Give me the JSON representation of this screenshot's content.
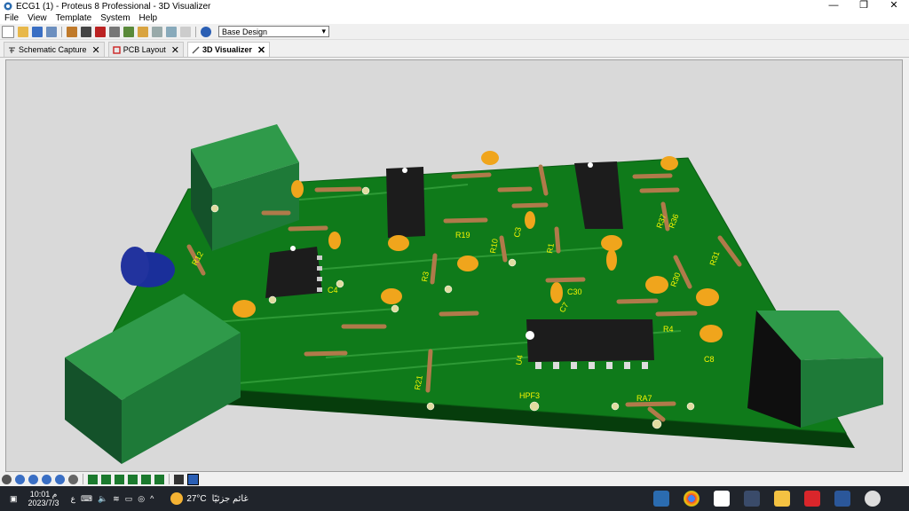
{
  "window": {
    "title": "ECG1 (1) - Proteus 8 Professional - 3D Visualizer",
    "minimize": "—",
    "maximize": "❐",
    "close": "✕"
  },
  "menu": [
    "File",
    "View",
    "Template",
    "System",
    "Help"
  ],
  "toolbar": {
    "variant_select": "Base Design"
  },
  "tabs": [
    {
      "label": "Schematic Capture",
      "icon": "schematic-icon",
      "active": false
    },
    {
      "label": "PCB Layout",
      "icon": "pcb-icon",
      "active": false
    },
    {
      "label": "3D Visualizer",
      "icon": "3d-icon",
      "active": true
    }
  ],
  "board": {
    "labels": [
      "R12",
      "R21",
      "R4",
      "R10",
      "R3",
      "U4",
      "HPF3",
      "C3",
      "R1",
      "R19",
      "C7",
      "C8",
      "C30",
      "R37",
      "R31",
      "R30",
      "R36",
      "RA7",
      "C4"
    ],
    "colors": {
      "pcb": "#0f7a1a",
      "pcb_edge": "#063d0c",
      "connector": "#1e7a38",
      "ic": "#1c1c1c",
      "capacitor": "#f0a51c",
      "viewport_bg": "#d9d9d9",
      "silkscreen": "#f5f500"
    }
  },
  "taskbar": {
    "time": "10:01 م",
    "date": "2023/7/3",
    "lang": "ع",
    "weather": "27°C",
    "weather_text": "غائم جزئيًا"
  }
}
